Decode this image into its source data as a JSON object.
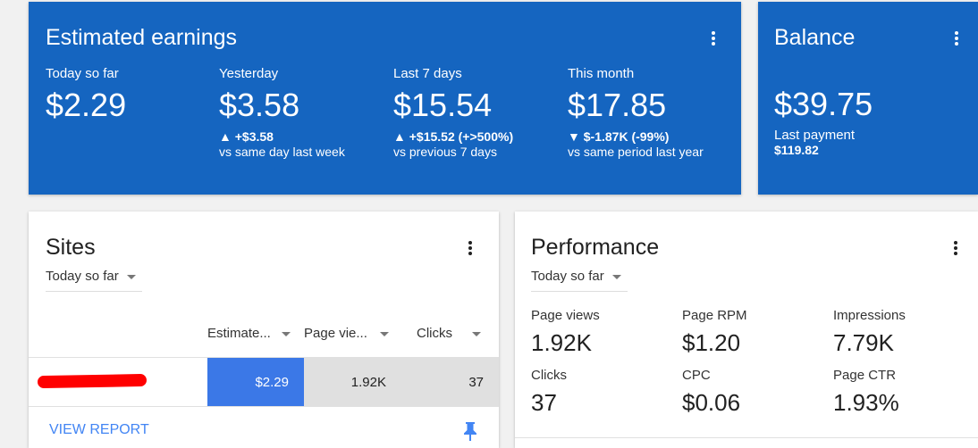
{
  "earnings": {
    "title": "Estimated earnings",
    "today": {
      "label": "Today so far",
      "value": "$2.29"
    },
    "yesterday": {
      "label": "Yesterday",
      "value": "$3.58",
      "change": "▲ +$3.58",
      "compare": "vs same day last week"
    },
    "last7": {
      "label": "Last 7 days",
      "value": "$15.54",
      "change": "▲ +$15.52 (+>500%)",
      "compare": "vs previous 7 days"
    },
    "month": {
      "label": "This month",
      "value": "$17.85",
      "change": "▼ $-1.87K (-99%)",
      "compare": "vs same period last year"
    }
  },
  "balance": {
    "title": "Balance",
    "value": "$39.75",
    "last_payment_label": "Last payment",
    "last_payment_value": "$119.82"
  },
  "sites": {
    "title": "Sites",
    "period": "Today so far",
    "columns": [
      "Estimate...",
      "Page vie...",
      "Clicks"
    ],
    "row": {
      "earnings": "$2.29",
      "page_views": "1.92K",
      "clicks": "37"
    },
    "view_report": "VIEW REPORT"
  },
  "performance": {
    "title": "Performance",
    "period": "Today so far",
    "metrics": [
      {
        "label": "Page views",
        "value": "1.92K"
      },
      {
        "label": "Page RPM",
        "value": "$1.20"
      },
      {
        "label": "Impressions",
        "value": "7.79K"
      },
      {
        "label": "Clicks",
        "value": "37"
      },
      {
        "label": "CPC",
        "value": "$0.06"
      },
      {
        "label": "Page CTR",
        "value": "1.93%"
      }
    ]
  },
  "colors": {
    "card_blue": "#1565c0",
    "highlight_blue": "#3b78e7",
    "link_blue": "#4285f4",
    "redaction": "#ff0000"
  },
  "icons": [
    "more-vert-icon",
    "dropdown-caret-icon",
    "pin-icon"
  ]
}
